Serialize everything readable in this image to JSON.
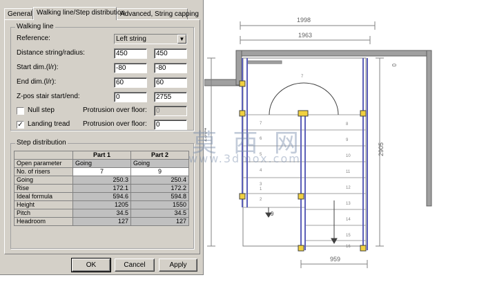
{
  "tabs": [
    {
      "label": "General"
    },
    {
      "label": "Walking line/Step distribution"
    },
    {
      "label": "Advanced, String capping"
    }
  ],
  "walking_line": {
    "title": "Walking line",
    "reference_label": "Reference:",
    "reference_value": "Left string",
    "rows": [
      {
        "label": "Distance string/radius:",
        "v1": "450",
        "v2": "450"
      },
      {
        "label": "Start dim.(l/r):",
        "v1": "-80",
        "v2": "-80"
      },
      {
        "label": "End dim.(l/r):",
        "v1": "60",
        "v2": "60"
      },
      {
        "label": "Z-pos stair start/end:",
        "v1": "0",
        "v2": "2755"
      }
    ],
    "null_step": {
      "label": "Null step",
      "checked": ""
    },
    "landing_tread": {
      "label": "Landing tread",
      "checked": "✓"
    },
    "protrusion_1": {
      "label": "Protrusion over floor:",
      "value": "0"
    },
    "protrusion_2": {
      "label": "Protrusion over floor:",
      "value": "0"
    }
  },
  "step_distribution": {
    "title": "Step distribution",
    "headers": [
      "",
      "Part 1",
      "Part 2"
    ],
    "rows": [
      {
        "name": "Open parameter",
        "p1": "Going",
        "p2": "Going"
      },
      {
        "name": "No. of risers",
        "p1": "7",
        "p2": "9"
      },
      {
        "name": "Going",
        "p1": "250.3",
        "p2": "250.4"
      },
      {
        "name": "Rise",
        "p1": "172.1",
        "p2": "172.2"
      },
      {
        "name": "Ideal formula",
        "p1": "594.6",
        "p2": "594.8"
      },
      {
        "name": "Height",
        "p1": "1205",
        "p2": "1550"
      },
      {
        "name": "Pitch",
        "p1": "34.5",
        "p2": "34.5"
      },
      {
        "name": "Headroom",
        "p1": "127",
        "p2": "127"
      }
    ]
  },
  "buttons": {
    "ok": "OK",
    "cancel": "Cancel",
    "apply": "Apply"
  },
  "drawing": {
    "dim_top1": "1998",
    "dim_top2": "1963",
    "dim_right": "2905",
    "dim_left": "2364",
    "dim_bottom": "959",
    "dim_zero": "0",
    "step_left_numbers": [
      "7",
      "6",
      "5",
      "4",
      "3",
      "2",
      "1"
    ],
    "step_right_numbers": [
      "8",
      "9",
      "10",
      "11",
      "12",
      "13",
      "14",
      "15",
      "16"
    ],
    "arc_label": "7",
    "walk_label": "9",
    "watermark": "莫 西 网",
    "watermark_url": "www.3dmox.com"
  },
  "colors": {
    "dialog_bg": "#d4d0c8",
    "stringer": "#5b5fb8",
    "wall": "#808080"
  }
}
